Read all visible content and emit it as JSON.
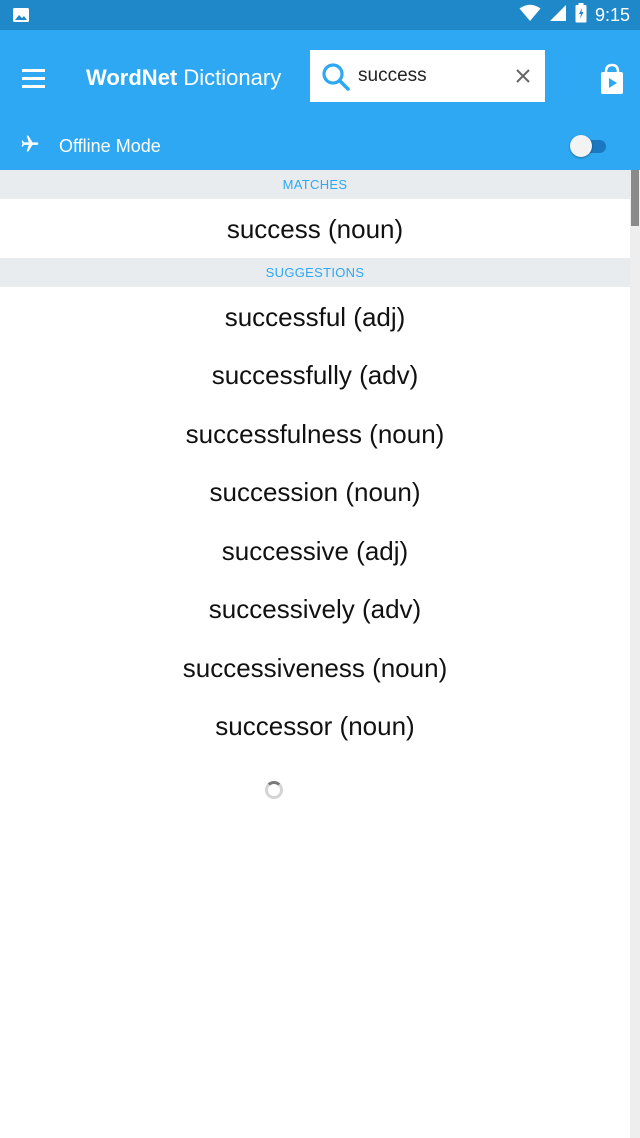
{
  "status_bar": {
    "time": "9:15",
    "icons": [
      "image-icon",
      "wifi-icon",
      "signal-icon",
      "battery-icon"
    ]
  },
  "app_bar": {
    "title_bold": "WordNet",
    "title_light": "Dictionary",
    "search": {
      "value": "success",
      "placeholder": ""
    },
    "icons": [
      "menu-icon",
      "search-icon",
      "close-icon",
      "play-store-icon"
    ]
  },
  "offline_mode": {
    "label": "Offline Mode",
    "enabled": false
  },
  "sections": {
    "matches_header": "MATCHES",
    "suggestions_header": "SUGGESTIONS"
  },
  "matches": [
    {
      "label": "success (noun)"
    }
  ],
  "suggestions": [
    {
      "label": "successful (adj)"
    },
    {
      "label": "successfully (adv)"
    },
    {
      "label": "successfulness (noun)"
    },
    {
      "label": "succession (noun)"
    },
    {
      "label": "successive (adj)"
    },
    {
      "label": "successively (adv)"
    },
    {
      "label": "successiveness (noun)"
    },
    {
      "label": "successor (noun)"
    }
  ],
  "colors": {
    "status_bar": "#1e88c9",
    "app_bar": "#2ea8f2",
    "section_header_bg": "#e9ecef",
    "accent": "#2ea8f2"
  }
}
